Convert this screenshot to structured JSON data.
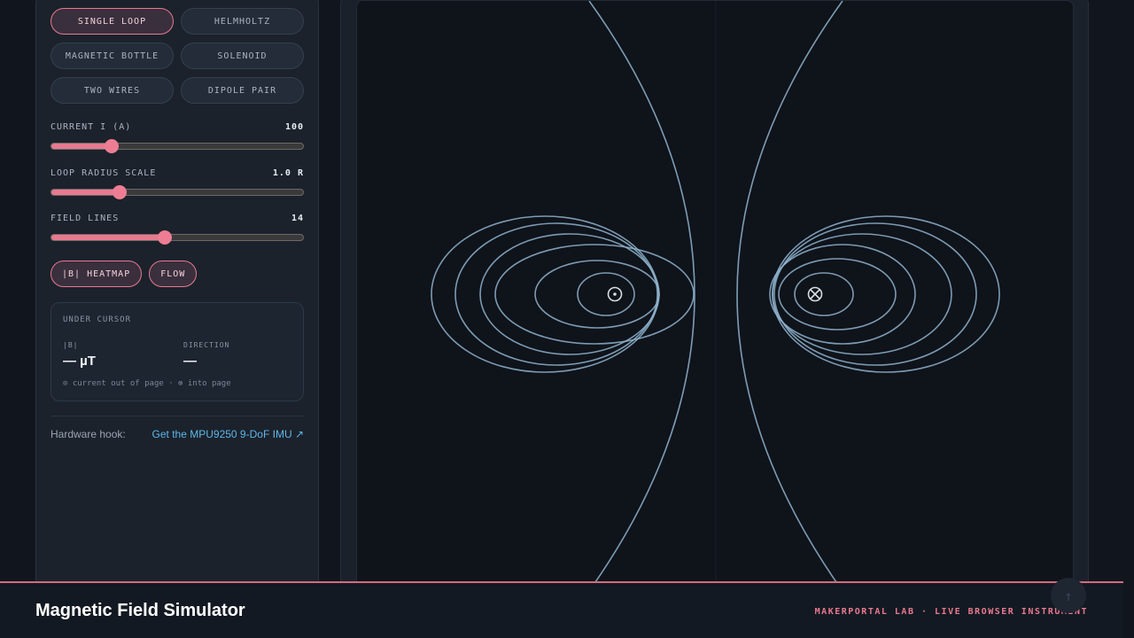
{
  "presets": [
    {
      "label": "SINGLE LOOP",
      "active": true
    },
    {
      "label": "HELMHOLTZ",
      "active": false
    },
    {
      "label": "MAGNETIC BOTTLE",
      "active": false
    },
    {
      "label": "SOLENOID",
      "active": false
    },
    {
      "label": "TWO WIRES",
      "active": false
    },
    {
      "label": "DIPOLE PAIR",
      "active": false
    }
  ],
  "sliders": {
    "current": {
      "label": "CURRENT I (A)",
      "value": "100",
      "fraction": 0.24
    },
    "radius": {
      "label": "LOOP RADIUS SCALE",
      "value": "1.0 R",
      "fraction": 0.27
    },
    "lines": {
      "label": "FIELD LINES",
      "value": "14",
      "fraction": 0.45
    }
  },
  "toggles": {
    "heatmap": "|B| HEATMAP",
    "flow": "FLOW"
  },
  "cursor": {
    "title": "UNDER CURSOR",
    "b_label": "|B|",
    "b_value": "— µT",
    "dir_label": "DIRECTION",
    "dir_value": "—",
    "note": "⊙ current out of page · ⊗ into page"
  },
  "hardware": {
    "label": "Hardware hook:",
    "link": "Get the MPU9250 9-DoF IMU ↗"
  },
  "footer": {
    "title": "Magnetic Field Simulator",
    "tag": "MAKERPORTAL LAB · LIVE BROWSER INSTRUMENT"
  },
  "scroll_top": "↑",
  "colors": {
    "accent": "#e8798f",
    "field_line": "#8fb4cf",
    "link": "#5fb6e8"
  }
}
